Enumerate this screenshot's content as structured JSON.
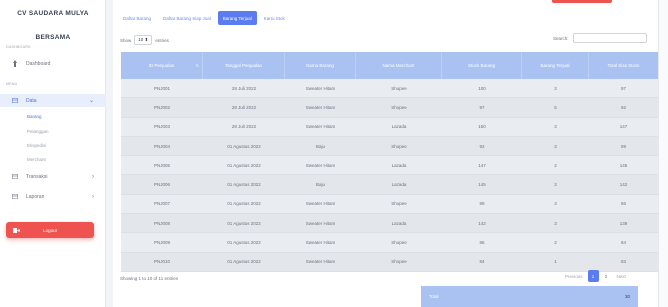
{
  "brand": {
    "line1": "CV SAUDARA MULYA",
    "line2": "BERSAMA"
  },
  "sidebar": {
    "section_dashboard": "DASHBOARD",
    "dashboard": "Dashboard",
    "section_menu": "MENU",
    "data": "Data",
    "data_sub": [
      "Barang",
      "Pelanggan",
      "Ekspedisi",
      "Merchant"
    ],
    "transaksi": "Transaksi",
    "laporan": "Laporan",
    "logout": "Logout"
  },
  "tabs": [
    "Daftar Barang",
    "Daftar Barang Siap Jual",
    "Barang Terjual",
    "Kartu Stok"
  ],
  "active_tab": 2,
  "controls": {
    "show": "Show",
    "entries_value": "10",
    "entries": "entries",
    "search": "Search:"
  },
  "table": {
    "headers": [
      "ID Penjualan",
      "Tanggal Penjualan",
      "Nama Barang",
      "Nama Merchant",
      "Stock Barang",
      "Barang Terjual",
      "Total Sisa Stock"
    ],
    "rows": [
      [
        "PNJ001",
        "28 Juli 2022",
        "Sweater Hitam",
        "Shopee",
        "100",
        "3",
        "97"
      ],
      [
        "PNJ002",
        "28 Juli 2022",
        "Sweater Hitam",
        "Shopee",
        "97",
        "5",
        "92"
      ],
      [
        "PNJ003",
        "28 Juli 2022",
        "Sweater Hitam",
        "Lazada",
        "150",
        "3",
        "147"
      ],
      [
        "PNJ004",
        "01 Agustus 2022",
        "Baju",
        "Shopee",
        "92",
        "3",
        "89"
      ],
      [
        "PNJ005",
        "01 Agustus 2022",
        "Sweater Hitam",
        "Lazada",
        "147",
        "2",
        "145"
      ],
      [
        "PNJ006",
        "01 Agustus 2022",
        "Baju",
        "Lazada",
        "145",
        "3",
        "142"
      ],
      [
        "PNJ007",
        "01 Agustus 2022",
        "Sweater Hitam",
        "Shopee",
        "89",
        "3",
        "86"
      ],
      [
        "PNJ008",
        "01 Agustus 2022",
        "Sweater Hitam",
        "Lazada",
        "142",
        "3",
        "139"
      ],
      [
        "PNJ009",
        "01 Agustus 2022",
        "Sweater Hitam",
        "Shopee",
        "86",
        "2",
        "84"
      ],
      [
        "PNJ010",
        "01 Agustus 2022",
        "Sweater Hitam",
        "Shopee",
        "84",
        "1",
        "83"
      ]
    ]
  },
  "footer": {
    "info": "Showing 1 to 10 of 11 entries",
    "prev": "Previous",
    "pages": [
      "1",
      "2"
    ],
    "next": "Next",
    "total_label": "Total",
    "total_value": "30"
  },
  "colors": {
    "accent": "#5b7cf0",
    "header": "#a9c2f2",
    "danger": "#ef5350"
  }
}
